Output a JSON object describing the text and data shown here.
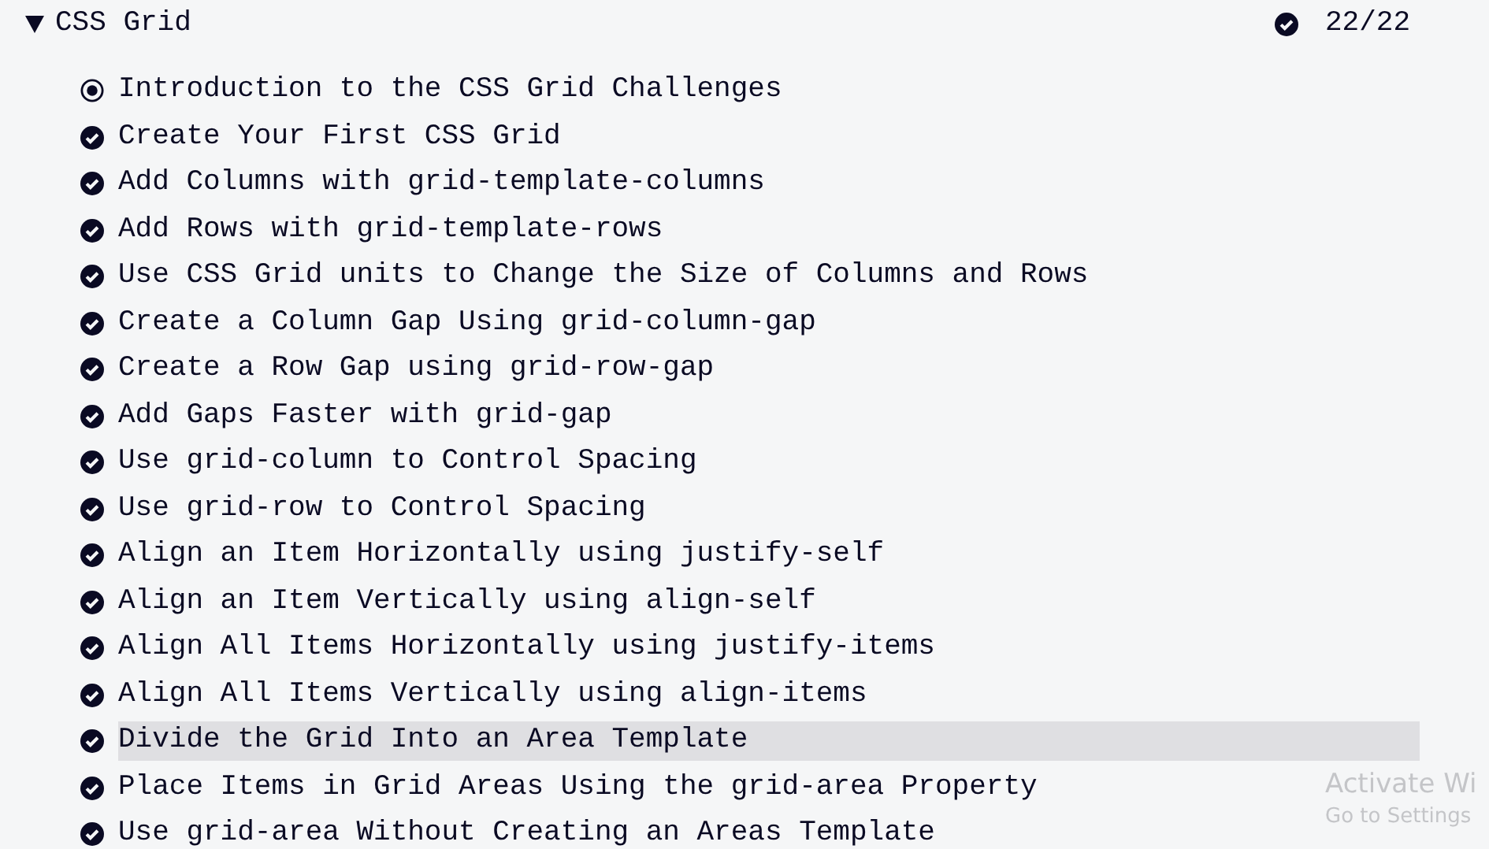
{
  "section": {
    "title": "CSS Grid",
    "expanded": true,
    "progress": "22/22",
    "complete": true
  },
  "challenges": [
    {
      "title": "Introduction to the CSS Grid Challenges",
      "completed": false,
      "selected": false
    },
    {
      "title": "Create Your First CSS Grid",
      "completed": true,
      "selected": false
    },
    {
      "title": "Add Columns with grid-template-columns",
      "completed": true,
      "selected": false
    },
    {
      "title": "Add Rows with grid-template-rows",
      "completed": true,
      "selected": false
    },
    {
      "title": "Use CSS Grid units to Change the Size of Columns and Rows",
      "completed": true,
      "selected": false
    },
    {
      "title": "Create a Column Gap Using grid-column-gap",
      "completed": true,
      "selected": false
    },
    {
      "title": "Create a Row Gap using grid-row-gap",
      "completed": true,
      "selected": false
    },
    {
      "title": "Add Gaps Faster with grid-gap",
      "completed": true,
      "selected": false
    },
    {
      "title": "Use grid-column to Control Spacing",
      "completed": true,
      "selected": false
    },
    {
      "title": "Use grid-row to Control Spacing",
      "completed": true,
      "selected": false
    },
    {
      "title": "Align an Item Horizontally using justify-self",
      "completed": true,
      "selected": false
    },
    {
      "title": "Align an Item Vertically using align-self",
      "completed": true,
      "selected": false
    },
    {
      "title": "Align All Items Horizontally using justify-items",
      "completed": true,
      "selected": false
    },
    {
      "title": "Align All Items Vertically using align-items",
      "completed": true,
      "selected": false
    },
    {
      "title": "Divide the Grid Into an Area Template",
      "completed": true,
      "selected": true
    },
    {
      "title": "Place Items in Grid Areas Using the grid-area Property",
      "completed": true,
      "selected": false
    },
    {
      "title": "Use grid-area Without Creating an Areas Template",
      "completed": true,
      "selected": false
    }
  ],
  "os_notice": {
    "title": "Activate Wi",
    "subtitle": "Go to Settings"
  }
}
